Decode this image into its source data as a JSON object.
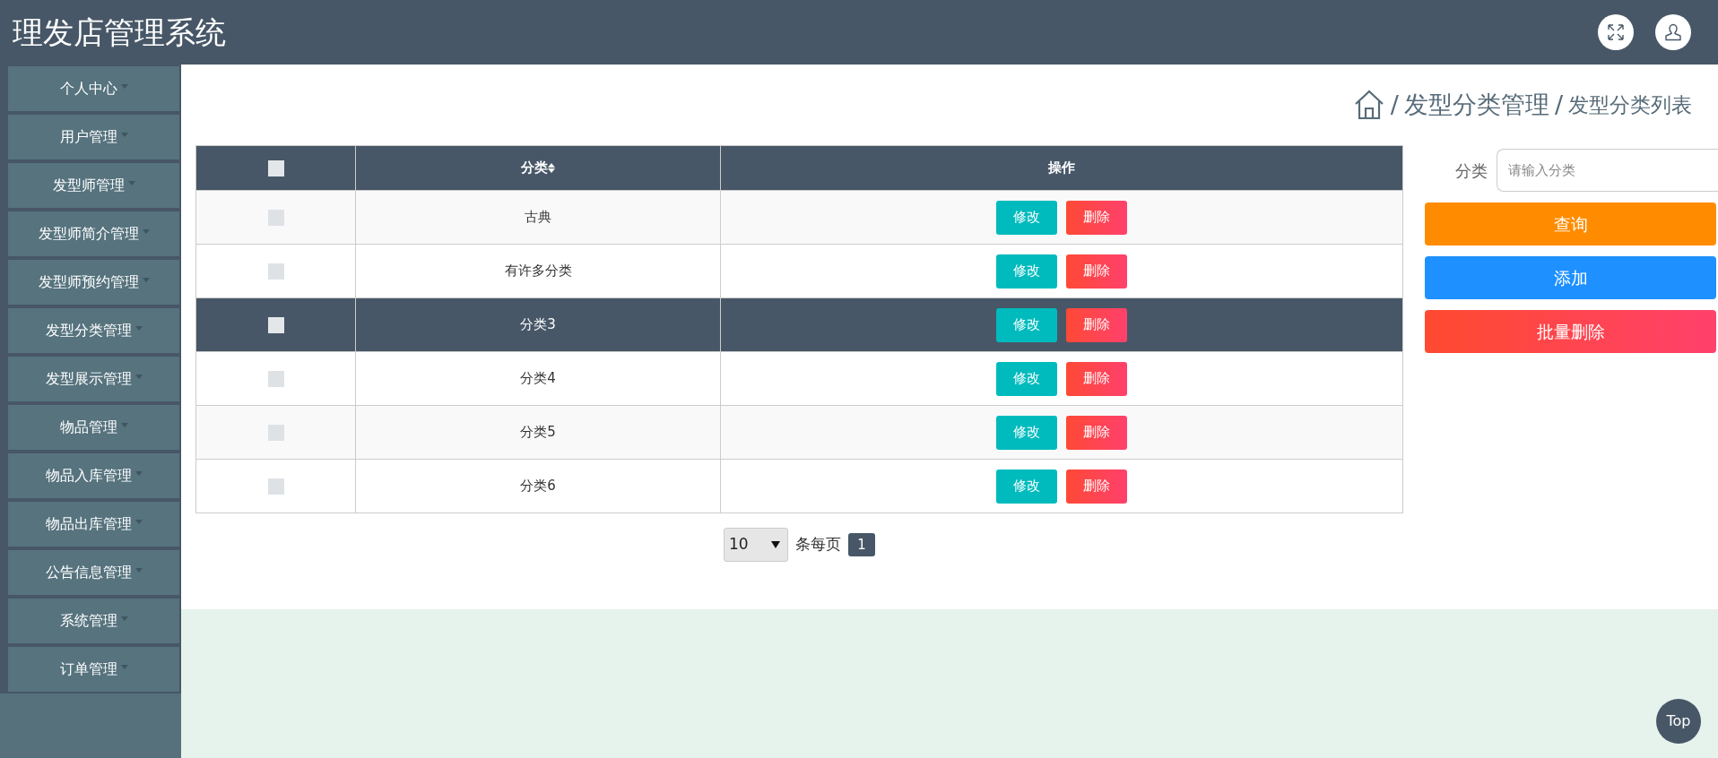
{
  "header": {
    "title": "理发店管理系统"
  },
  "sidebar": {
    "items": [
      {
        "label": "个人中心"
      },
      {
        "label": "用户管理"
      },
      {
        "label": "发型师管理"
      },
      {
        "label": "发型师简介管理"
      },
      {
        "label": "发型师预约管理"
      },
      {
        "label": "发型分类管理"
      },
      {
        "label": "发型展示管理"
      },
      {
        "label": "物品管理"
      },
      {
        "label": "物品入库管理"
      },
      {
        "label": "物品出库管理"
      },
      {
        "label": "公告信息管理"
      },
      {
        "label": "系统管理"
      },
      {
        "label": "订单管理"
      }
    ]
  },
  "breadcrumb": {
    "separator": "/",
    "items": [
      "发型分类管理",
      "发型分类列表"
    ]
  },
  "table": {
    "select_all": {
      "checked": false
    },
    "columns": [
      "分类",
      "操作"
    ],
    "rows": [
      {
        "checked": false,
        "hovered": false,
        "category": "古典",
        "actions": [
          "修改",
          "删除"
        ]
      },
      {
        "checked": false,
        "hovered": false,
        "category": "有许多分类",
        "actions": [
          "修改",
          "删除"
        ]
      },
      {
        "checked": false,
        "hovered": true,
        "category": "分类3",
        "actions": [
          "修改",
          "删除"
        ]
      },
      {
        "checked": false,
        "hovered": false,
        "category": "分类4",
        "actions": [
          "修改",
          "删除"
        ]
      },
      {
        "checked": false,
        "hovered": false,
        "category": "分类5",
        "actions": [
          "修改",
          "删除"
        ]
      },
      {
        "checked": false,
        "hovered": false,
        "category": "分类6",
        "actions": [
          "修改",
          "删除"
        ]
      }
    ]
  },
  "search": {
    "label": "分类",
    "placeholder": "请输入分类",
    "buttons": [
      {
        "kind": "query",
        "label": "查询"
      },
      {
        "kind": "add",
        "label": "添加"
      },
      {
        "kind": "batch-delete",
        "label": "批量删除"
      }
    ]
  },
  "pagination": {
    "page_size": "10",
    "per_page_label": "条每页",
    "pages": [
      {
        "label": "1",
        "selected": true
      }
    ]
  },
  "back_to_top": "Top"
}
